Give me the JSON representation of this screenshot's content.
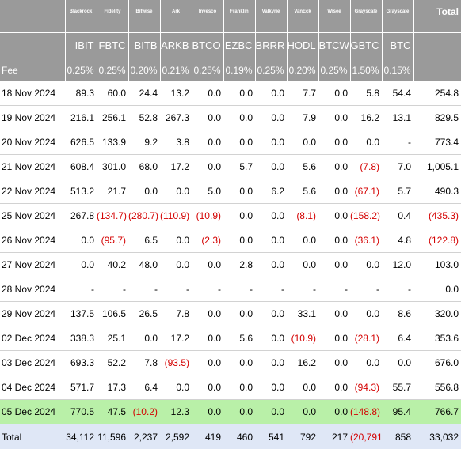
{
  "chart_data": {
    "type": "table",
    "header": {
      "issuers": [
        "Blackrock",
        "Fidelity",
        "Bitwise",
        "Ark",
        "Invesco",
        "Franklin",
        "Valkyrie",
        "VanEck",
        "Wisee",
        "Grayscale",
        "Grayscale"
      ],
      "total_label": "Total",
      "tickers": [
        "IBIT",
        "FBTC",
        "BITB",
        "ARKB",
        "BTCO",
        "EZBC",
        "BRRR",
        "HODL",
        "BTCW",
        "GBTC",
        "BTC"
      ],
      "fee_label": "Fee",
      "fees": [
        "0.25%",
        "0.25%",
        "0.20%",
        "0.21%",
        "0.25%",
        "0.19%",
        "0.25%",
        "0.20%",
        "0.25%",
        "1.50%",
        "0.15%"
      ]
    },
    "rows": [
      {
        "date": "18 Nov 2024",
        "values": [
          "89.3",
          "60.0",
          "24.4",
          "13.2",
          "0.0",
          "0.0",
          "0.0",
          "7.7",
          "0.0",
          "5.8",
          "54.4"
        ],
        "total": "254.8"
      },
      {
        "date": "19 Nov 2024",
        "values": [
          "216.1",
          "256.1",
          "52.8",
          "267.3",
          "0.0",
          "0.0",
          "0.0",
          "7.9",
          "0.0",
          "16.2",
          "13.1"
        ],
        "total": "829.5"
      },
      {
        "date": "20 Nov 2024",
        "values": [
          "626.5",
          "133.9",
          "9.2",
          "3.8",
          "0.0",
          "0.0",
          "0.0",
          "0.0",
          "0.0",
          "0.0",
          "-"
        ],
        "total": "773.4"
      },
      {
        "date": "21 Nov 2024",
        "values": [
          "608.4",
          "301.0",
          "68.0",
          "17.2",
          "0.0",
          "5.7",
          "0.0",
          "5.6",
          "0.0",
          "(7.8)",
          "7.0"
        ],
        "total": "1,005.1"
      },
      {
        "date": "22 Nov 2024",
        "values": [
          "513.2",
          "21.7",
          "0.0",
          "0.0",
          "5.0",
          "0.0",
          "6.2",
          "5.6",
          "0.0",
          "(67.1)",
          "5.7"
        ],
        "total": "490.3"
      },
      {
        "date": "25 Nov 2024",
        "values": [
          "267.8",
          "(134.7)",
          "(280.7)",
          "(110.9)",
          "(10.9)",
          "0.0",
          "0.0",
          "(8.1)",
          "0.0",
          "(158.2)",
          "0.4"
        ],
        "total": "(435.3)"
      },
      {
        "date": "26 Nov 2024",
        "values": [
          "0.0",
          "(95.7)",
          "6.5",
          "0.0",
          "(2.3)",
          "0.0",
          "0.0",
          "0.0",
          "0.0",
          "(36.1)",
          "4.8"
        ],
        "total": "(122.8)"
      },
      {
        "date": "27 Nov 2024",
        "values": [
          "0.0",
          "40.2",
          "48.0",
          "0.0",
          "0.0",
          "2.8",
          "0.0",
          "0.0",
          "0.0",
          "0.0",
          "12.0"
        ],
        "total": "103.0"
      },
      {
        "date": "28 Nov 2024",
        "values": [
          "-",
          "-",
          "-",
          "-",
          "-",
          "-",
          "-",
          "-",
          "-",
          "-",
          "-"
        ],
        "total": "0.0"
      },
      {
        "date": "29 Nov 2024",
        "values": [
          "137.5",
          "106.5",
          "26.5",
          "7.8",
          "0.0",
          "0.0",
          "0.0",
          "33.1",
          "0.0",
          "0.0",
          "8.6"
        ],
        "total": "320.0"
      },
      {
        "date": "02 Dec 2024",
        "values": [
          "338.3",
          "25.1",
          "0.0",
          "17.2",
          "0.0",
          "5.6",
          "0.0",
          "(10.9)",
          "0.0",
          "(28.1)",
          "6.4"
        ],
        "total": "353.6"
      },
      {
        "date": "03 Dec 2024",
        "values": [
          "693.3",
          "52.2",
          "7.8",
          "(93.5)",
          "0.0",
          "0.0",
          "0.0",
          "16.2",
          "0.0",
          "0.0",
          "0.0"
        ],
        "total": "676.0"
      },
      {
        "date": "04 Dec 2024",
        "values": [
          "571.7",
          "17.3",
          "6.4",
          "0.0",
          "0.0",
          "0.0",
          "0.0",
          "0.0",
          "0.0",
          "(94.3)",
          "55.7"
        ],
        "total": "556.8"
      },
      {
        "date": "05 Dec 2024",
        "values": [
          "770.5",
          "47.5",
          "(10.2)",
          "12.3",
          "0.0",
          "0.0",
          "0.0",
          "0.0",
          "0.0",
          "(148.8)",
          "95.4"
        ],
        "total": "766.7",
        "highlight": true
      }
    ],
    "totals": {
      "label": "Total",
      "values": [
        "34,112",
        "11,596",
        "2,237",
        "2,592",
        "419",
        "460",
        "541",
        "792",
        "217",
        "(20,791)",
        "858"
      ],
      "total": "33,032"
    }
  },
  "colors": {
    "header_bg": "#9a9a9a",
    "header_text": "#ffffff",
    "negative": "#d40000",
    "highlight_row": "#b9f0a8",
    "total_row": "#dfe7f6",
    "row_divider": "#d2d2d2"
  }
}
